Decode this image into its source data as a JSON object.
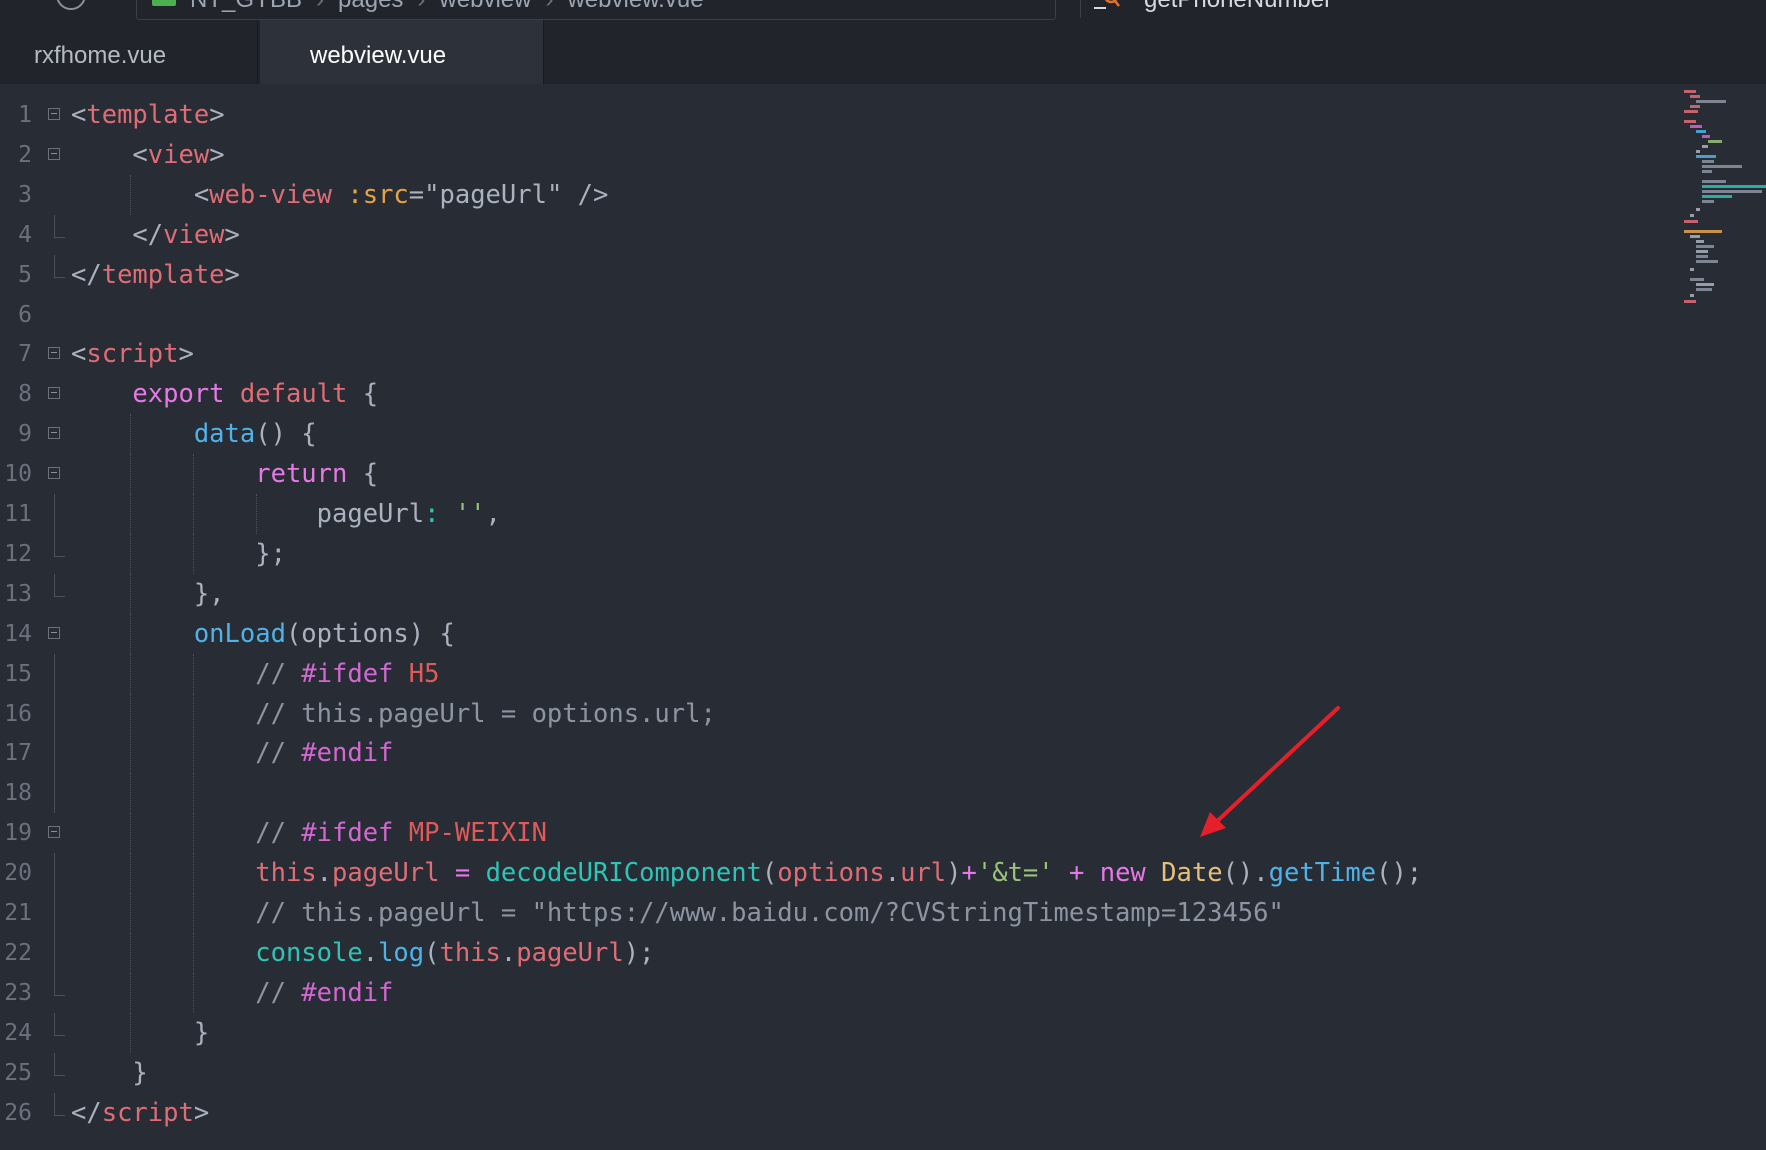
{
  "breadcrumb": {
    "items": [
      "NT_GYBB",
      "pages",
      "webview",
      "webview.vue"
    ],
    "search_text": "getPhoneNumber"
  },
  "tabs": [
    {
      "label": "rxfhome.vue",
      "active": false
    },
    {
      "label": "webview.vue",
      "active": true
    }
  ],
  "editor": {
    "line_numbers": [
      "1",
      "2",
      "3",
      "4",
      "5",
      "6",
      "7",
      "8",
      "9",
      "10",
      "11",
      "12",
      "13",
      "14",
      "15",
      "16",
      "17",
      "18",
      "19",
      "20",
      "21",
      "22",
      "23",
      "24",
      "25",
      "26"
    ],
    "lines": [
      [
        [
          "t-plain",
          "<"
        ],
        [
          "t-tag",
          "template"
        ],
        [
          "t-plain",
          ">"
        ]
      ],
      [
        [
          "t-plain",
          "    <"
        ],
        [
          "t-tag",
          "view"
        ],
        [
          "t-plain",
          ">"
        ]
      ],
      [
        [
          "t-plain",
          "        <"
        ],
        [
          "t-tag",
          "web-view"
        ],
        [
          "t-plain",
          " "
        ],
        [
          "t-attr",
          ":src"
        ],
        [
          "t-plain",
          "=\"pageUrl\" />"
        ]
      ],
      [
        [
          "t-plain",
          "    </"
        ],
        [
          "t-tag",
          "view"
        ],
        [
          "t-plain",
          ">"
        ]
      ],
      [
        [
          "t-plain",
          "</"
        ],
        [
          "t-tag",
          "template"
        ],
        [
          "t-plain",
          ">"
        ]
      ],
      [],
      [
        [
          "t-plain",
          "<"
        ],
        [
          "t-tag",
          "script"
        ],
        [
          "t-plain",
          ">"
        ]
      ],
      [
        [
          "t-plain",
          "    "
        ],
        [
          "t-kw",
          "export"
        ],
        [
          "t-plain",
          " "
        ],
        [
          "t-kw2",
          "default"
        ],
        [
          "t-plain",
          " {"
        ]
      ],
      [
        [
          "t-plain",
          "        "
        ],
        [
          "t-fn",
          "data"
        ],
        [
          "t-plain",
          "() {"
        ]
      ],
      [
        [
          "t-plain",
          "            "
        ],
        [
          "t-kw",
          "return"
        ],
        [
          "t-plain",
          " {"
        ]
      ],
      [
        [
          "t-plain",
          "                pageUrl"
        ],
        [
          "t-cyan",
          ":"
        ],
        [
          "t-plain",
          " "
        ],
        [
          "t-str",
          "''"
        ],
        [
          "t-plain",
          ","
        ]
      ],
      [
        [
          "t-plain",
          "            };"
        ]
      ],
      [
        [
          "t-plain",
          "        },"
        ]
      ],
      [
        [
          "t-plain",
          "        "
        ],
        [
          "t-fn",
          "onLoad"
        ],
        [
          "t-plain",
          "(options) {"
        ]
      ],
      [
        [
          "t-plain",
          "            "
        ],
        [
          "t-cmt",
          "// "
        ],
        [
          "t-dir",
          "#ifdef"
        ],
        [
          "t-plain",
          " "
        ],
        [
          "t-macro",
          "H5"
        ]
      ],
      [
        [
          "t-plain",
          "            "
        ],
        [
          "t-cmt",
          "// this.pageUrl = options.url;"
        ]
      ],
      [
        [
          "t-plain",
          "            "
        ],
        [
          "t-cmt",
          "// "
        ],
        [
          "t-dir",
          "#endif"
        ]
      ],
      [],
      [
        [
          "t-plain",
          "            "
        ],
        [
          "t-cmt",
          "// "
        ],
        [
          "t-dir",
          "#ifdef"
        ],
        [
          "t-plain",
          " "
        ],
        [
          "t-macro",
          "MP-WEIXIN"
        ]
      ],
      [
        [
          "t-plain",
          "            "
        ],
        [
          "t-this",
          "this"
        ],
        [
          "t-plain",
          "."
        ],
        [
          "t-prop",
          "pageUrl"
        ],
        [
          "t-plain",
          " "
        ],
        [
          "t-kw",
          "="
        ],
        [
          "t-plain",
          " "
        ],
        [
          "t-cyan",
          "decodeURIComponent"
        ],
        [
          "t-plain",
          "("
        ],
        [
          "t-this",
          "options"
        ],
        [
          "t-plain",
          "."
        ],
        [
          "t-prop",
          "url"
        ],
        [
          "t-plain",
          ")"
        ],
        [
          "t-kw",
          "+"
        ],
        [
          "t-str",
          "'&t='"
        ],
        [
          "t-plain",
          " "
        ],
        [
          "t-kw",
          "+"
        ],
        [
          "t-plain",
          " "
        ],
        [
          "t-kw",
          "new"
        ],
        [
          "t-plain",
          " "
        ],
        [
          "t-cls",
          "Date"
        ],
        [
          "t-plain",
          "()."
        ],
        [
          "t-fn",
          "getTime"
        ],
        [
          "t-plain",
          "();"
        ]
      ],
      [
        [
          "t-plain",
          "            "
        ],
        [
          "t-cmt",
          "// this.pageUrl = \"https://www.baidu.com/?CVStringTimestamp=123456\""
        ]
      ],
      [
        [
          "t-plain",
          "            "
        ],
        [
          "t-cyan",
          "console"
        ],
        [
          "t-plain",
          "."
        ],
        [
          "t-fn",
          "log"
        ],
        [
          "t-plain",
          "("
        ],
        [
          "t-this",
          "this"
        ],
        [
          "t-plain",
          "."
        ],
        [
          "t-prop",
          "pageUrl"
        ],
        [
          "t-plain",
          ");"
        ]
      ],
      [
        [
          "t-plain",
          "            "
        ],
        [
          "t-cmt",
          "// "
        ],
        [
          "t-dir",
          "#endif"
        ]
      ],
      [
        [
          "t-plain",
          "        }"
        ]
      ],
      [
        [
          "t-plain",
          "    }"
        ]
      ],
      [
        [
          "t-plain",
          "</"
        ],
        [
          "t-tag",
          "script"
        ],
        [
          "t-plain",
          ">"
        ]
      ]
    ],
    "fold_markers": [
      "open",
      "open",
      "",
      "end",
      "end",
      "",
      "open",
      "open",
      "open",
      "open",
      "mid",
      "end",
      "end",
      "open",
      "mid",
      "mid",
      "mid",
      "mid",
      "open",
      "mid",
      "mid",
      "mid",
      "end",
      "end",
      "end",
      "end"
    ]
  },
  "colors": {
    "background": "#282c34",
    "tab_bar": "#21252b",
    "active_tab": "#2d313a",
    "arrow": "#e5202a"
  },
  "icons": [
    "history-icon",
    "project-icon",
    "search-icon",
    "fold-toggle-icon",
    "annotation-arrow"
  ]
}
